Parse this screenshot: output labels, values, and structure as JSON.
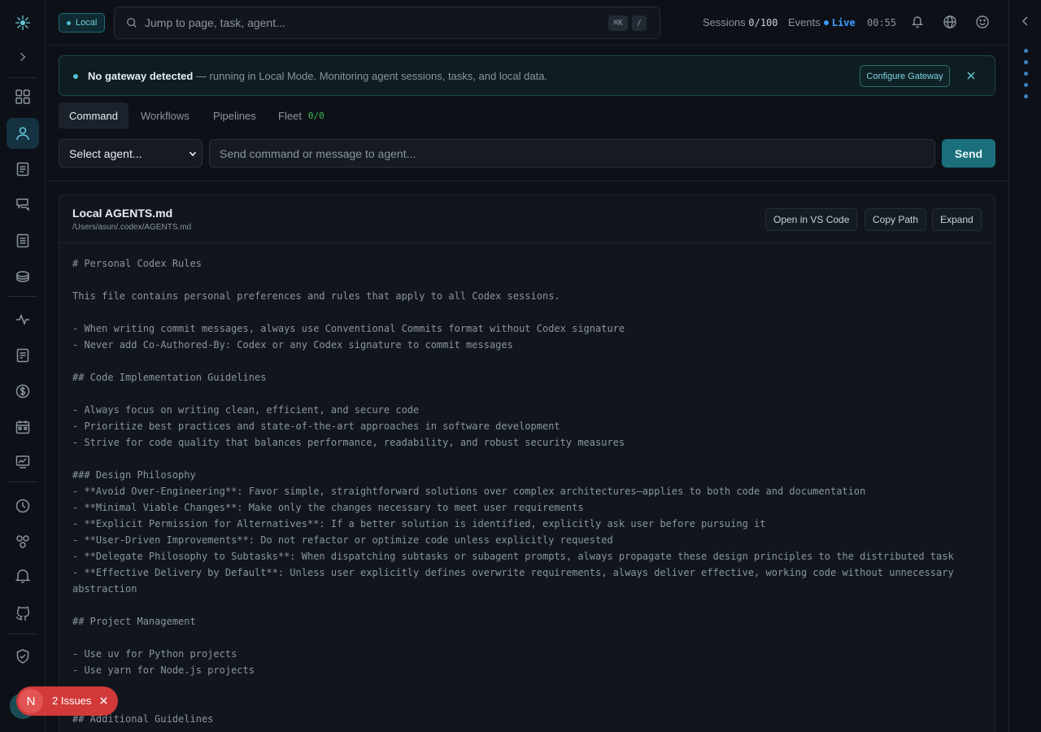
{
  "topbar": {
    "mode_badge": "Local",
    "search_placeholder": "Jump to page, task, agent...",
    "shortcut_keys": [
      "⌘K",
      "/"
    ],
    "sessions_label": "Sessions",
    "sessions_value": "0/100",
    "events_label": "Events",
    "live_label": "Live",
    "clock": "00:55",
    "icons": [
      "bulb-icon",
      "globe-icon",
      "smiley-icon"
    ]
  },
  "banner": {
    "title": "No gateway detected",
    "message": " — running in Local Mode. Monitoring agent sessions, tasks, and local data.",
    "action_label": "Configure Gateway"
  },
  "tabs": [
    {
      "label": "Command",
      "active": true
    },
    {
      "label": "Workflows"
    },
    {
      "label": "Pipelines"
    },
    {
      "label": "Fleet",
      "count": "0/0"
    }
  ],
  "command": {
    "agent_select_value": "Select agent...",
    "input_placeholder": "Send command or message to agent...",
    "send_label": "Send"
  },
  "panel": {
    "title": "Local AGENTS.md",
    "path": "/Users/asun/.codex/AGENTS.md",
    "buttons": [
      "Open in VS Code",
      "Copy Path",
      "Expand"
    ],
    "lines": [
      "# Personal Codex Rules",
      "",
      "This file contains personal preferences and rules that apply to all Codex sessions.",
      "",
      "- When writing commit messages, always use Conventional Commits format without Codex signature",
      "- Never add Co-Authored-By: Codex or any Codex signature to commit messages",
      "",
      "## Code Implementation Guidelines",
      "",
      "- Always focus on writing clean, efficient, and secure code",
      "- Prioritize best practices and state-of-the-art approaches in software development",
      "- Strive for code quality that balances performance, readability, and robust security measures",
      "",
      "### Design Philosophy",
      "- **Avoid Over-Engineering**: Favor simple, straightforward solutions over complex architectures—applies to both code and documentation",
      "- **Minimal Viable Changes**: Make only the changes necessary to meet user requirements",
      "- **Explicit Permission for Alternatives**: If a better solution is identified, explicitly ask user before pursuing it",
      "- **User-Driven Improvements**: Do not refactor or optimize code unless explicitly requested",
      "- **Delegate Philosophy to Subtasks**: When dispatching subtasks or subagent prompts, always propagate these design principles to the distributed task",
      "- **Effective Delivery by Default**: Unless user explicitly defines overwrite requirements, always deliver effective, working code without unnecessary",
      "abstraction",
      "",
      "## Project Management",
      "",
      "- Use uv for Python projects",
      "- Use yarn for Node.js projects",
      "",
      "",
      "## Additional Guidelines"
    ]
  },
  "issues_toast": {
    "avatar_letter": "N",
    "label": "2 Issues"
  },
  "sidebar": {
    "items": [
      "dashboard-icon",
      "agents-icon",
      "tasks-icon",
      "chat-icon",
      "logs-icon",
      "database-icon",
      "activity-icon",
      "docs-icon",
      "cost-icon",
      "calendar-icon",
      "metrics-icon",
      "history-icon",
      "integrations-icon",
      "alerts-icon",
      "github-icon",
      "security-icon"
    ]
  }
}
